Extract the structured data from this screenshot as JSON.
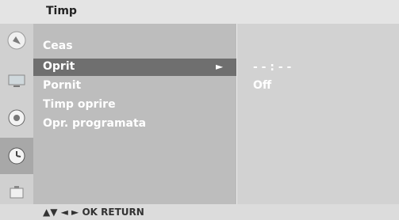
{
  "header": {
    "title": "Timp"
  },
  "menu": {
    "items": [
      {
        "label": "Ceas"
      },
      {
        "label": "Oprit"
      },
      {
        "label": "Pornit"
      },
      {
        "label": "Timp oprire"
      },
      {
        "label": "Opr. programata"
      }
    ],
    "selected_arrow": "►"
  },
  "panel": {
    "time_value": "- - : - -",
    "status_value": "Off"
  },
  "footer": {
    "hint": "▲▼  ◄ ►  OK  RETURN"
  },
  "sidebar": {
    "icons": [
      "picture-icon",
      "screen-icon",
      "speaker-icon",
      "clock-icon",
      "toolbox-icon"
    ]
  }
}
